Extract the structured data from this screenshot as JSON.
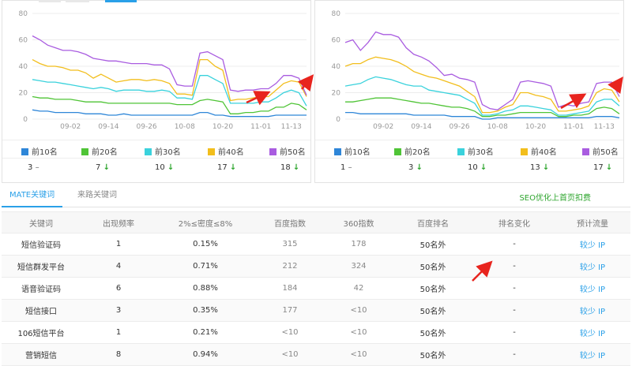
{
  "charts": [
    {
      "id": "left",
      "x_ticks": [
        "09-02",
        "09-14",
        "09-26",
        "10-08",
        "10-20",
        "11-01",
        "11-13"
      ],
      "y_ticks": [
        "0",
        "20",
        "40",
        "60",
        "80"
      ],
      "legend": [
        "前10名",
        "前20名",
        "前30名",
        "前40名",
        "前50名"
      ],
      "counts": [
        {
          "value": "3",
          "trend": "–"
        },
        {
          "value": "7",
          "trend": "↓"
        },
        {
          "value": "10",
          "trend": "↓"
        },
        {
          "value": "17",
          "trend": "↓"
        },
        {
          "value": "18",
          "trend": "↓"
        }
      ]
    },
    {
      "id": "right",
      "x_ticks": [
        "09-02",
        "09-14",
        "09-26",
        "10-08",
        "10-20",
        "11-01",
        "11-13"
      ],
      "y_ticks": [
        "0",
        "20",
        "40",
        "60",
        "80"
      ],
      "legend": [
        "前10名",
        "前20名",
        "前30名",
        "前40名",
        "前50名"
      ],
      "counts": [
        {
          "value": "1",
          "trend": "–"
        },
        {
          "value": "3",
          "trend": "↓"
        },
        {
          "value": "10",
          "trend": "↓"
        },
        {
          "value": "13",
          "trend": "↓"
        },
        {
          "value": "17",
          "trend": "↓"
        }
      ]
    }
  ],
  "series_colors": [
    "#2e86d8",
    "#4fc436",
    "#3ad2dc",
    "#f2be1c",
    "#a95ce0"
  ],
  "chart_data": [
    {
      "type": "line",
      "ylim": [
        0,
        80
      ],
      "x_ticks": [
        "09-02",
        "09-14",
        "09-26",
        "10-08",
        "10-20",
        "11-01",
        "11-13"
      ],
      "series": [
        {
          "name": "前10名",
          "values": [
            7,
            6,
            6,
            5,
            5,
            5,
            5,
            4,
            4,
            4,
            3,
            3,
            4,
            3,
            3,
            3,
            3,
            3,
            3,
            3,
            3,
            3,
            5,
            5,
            3,
            3,
            2,
            2,
            2,
            2,
            2,
            2,
            3,
            3,
            3,
            3,
            3
          ]
        },
        {
          "name": "前20名",
          "values": [
            17,
            16,
            16,
            15,
            15,
            15,
            14,
            13,
            13,
            13,
            12,
            12,
            12,
            12,
            12,
            12,
            12,
            12,
            12,
            11,
            11,
            11,
            14,
            15,
            14,
            13,
            4,
            4,
            5,
            5,
            6,
            6,
            9,
            9,
            12,
            11,
            7
          ]
        },
        {
          "name": "前30名",
          "values": [
            30,
            29,
            28,
            28,
            27,
            26,
            25,
            24,
            23,
            24,
            23,
            21,
            22,
            22,
            22,
            21,
            21,
            22,
            21,
            16,
            16,
            15,
            33,
            33,
            30,
            27,
            12,
            12,
            12,
            12,
            13,
            13,
            16,
            20,
            22,
            20,
            10
          ]
        },
        {
          "name": "前40名",
          "values": [
            45,
            42,
            40,
            40,
            39,
            37,
            37,
            35,
            31,
            34,
            31,
            28,
            29,
            30,
            30,
            29,
            30,
            29,
            27,
            19,
            19,
            18,
            45,
            45,
            40,
            37,
            14,
            15,
            15,
            16,
            17,
            17,
            22,
            27,
            29,
            28,
            17
          ]
        },
        {
          "name": "前50名",
          "values": [
            63,
            60,
            56,
            54,
            52,
            52,
            51,
            49,
            46,
            45,
            44,
            44,
            43,
            42,
            42,
            42,
            41,
            41,
            38,
            26,
            25,
            25,
            50,
            51,
            48,
            45,
            22,
            21,
            22,
            22,
            23,
            23,
            27,
            33,
            33,
            31,
            18
          ]
        }
      ]
    },
    {
      "type": "line",
      "ylim": [
        0,
        80
      ],
      "x_ticks": [
        "09-02",
        "09-14",
        "09-26",
        "10-08",
        "10-20",
        "11-01",
        "11-13"
      ],
      "series": [
        {
          "name": "前10名",
          "values": [
            5,
            5,
            4,
            4,
            4,
            4,
            4,
            4,
            4,
            3,
            3,
            3,
            3,
            3,
            2,
            2,
            2,
            2,
            0,
            0,
            1,
            1,
            1,
            1,
            1,
            1,
            1,
            1,
            1,
            1,
            1,
            1,
            1,
            2,
            2,
            2,
            1
          ]
        },
        {
          "name": "前20名",
          "values": [
            13,
            13,
            14,
            15,
            16,
            16,
            16,
            15,
            14,
            13,
            12,
            12,
            11,
            10,
            9,
            9,
            8,
            6,
            2,
            2,
            3,
            3,
            4,
            5,
            5,
            5,
            5,
            5,
            2,
            2,
            3,
            3,
            4,
            8,
            9,
            8,
            4
          ]
        },
        {
          "name": "前30名",
          "values": [
            25,
            26,
            27,
            30,
            32,
            31,
            30,
            28,
            26,
            25,
            25,
            22,
            21,
            20,
            19,
            18,
            15,
            12,
            3,
            3,
            4,
            6,
            7,
            10,
            10,
            9,
            8,
            7,
            3,
            3,
            4,
            5,
            6,
            13,
            15,
            15,
            10
          ]
        },
        {
          "name": "前40名",
          "values": [
            40,
            42,
            42,
            45,
            47,
            46,
            45,
            43,
            40,
            36,
            34,
            32,
            31,
            29,
            27,
            25,
            21,
            17,
            5,
            5,
            6,
            9,
            11,
            20,
            20,
            18,
            17,
            15,
            6,
            6,
            7,
            8,
            10,
            20,
            23,
            22,
            13
          ]
        },
        {
          "name": "前50名",
          "values": [
            58,
            60,
            52,
            58,
            66,
            64,
            64,
            62,
            54,
            49,
            47,
            44,
            39,
            33,
            34,
            31,
            30,
            28,
            11,
            8,
            7,
            11,
            15,
            28,
            29,
            28,
            27,
            25,
            9,
            11,
            10,
            12,
            13,
            27,
            28,
            28,
            17
          ]
        }
      ]
    }
  ],
  "keyword_tabs": [
    "MATE关键词",
    "来路关键词"
  ],
  "promo": "SEO优化上首页扣费",
  "table": {
    "headers": [
      "关键词",
      "出现频率",
      "2%≤密度≤8%",
      "百度指数",
      "360指数",
      "百度排名",
      "排名变化",
      "预计流量"
    ],
    "rows": [
      [
        "短信验证码",
        "1",
        "0.15%",
        "315",
        "178",
        "50名外",
        "-",
        "较少 IP"
      ],
      [
        "短信群发平台",
        "4",
        "0.71%",
        "212",
        "324",
        "50名外",
        "-",
        "较少 IP"
      ],
      [
        "语音验证码",
        "6",
        "0.88%",
        "184",
        "42",
        "50名外",
        "-",
        "较少 IP"
      ],
      [
        "短信接口",
        "3",
        "0.35%",
        "177",
        "<10",
        "50名外",
        "-",
        "较少 IP"
      ],
      [
        "106短信平台",
        "1",
        "0.21%",
        "<10",
        "<10",
        "50名外",
        "-",
        "较少 IP"
      ],
      [
        "营销短信",
        "8",
        "0.94%",
        "<10",
        "<10",
        "50名外",
        "-",
        "较少 IP"
      ]
    ]
  }
}
